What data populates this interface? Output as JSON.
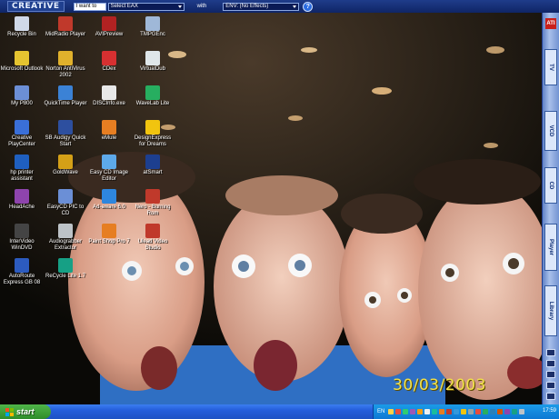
{
  "toolbar": {
    "logo": "CREATIVE",
    "want_label": "I want to",
    "eax_select": "Select EAX",
    "with_label": "with",
    "effect_select": "ENV: (No Effects)"
  },
  "desktop_icons": [
    {
      "name": "recycle-bin",
      "label": "Recycle Bin",
      "color": "#cfd8e8"
    },
    {
      "name": "midradio-player",
      "label": "MidRadio Player",
      "color": "#c0392b"
    },
    {
      "name": "avipreview",
      "label": "AVIPreview",
      "color": "#b22222"
    },
    {
      "name": "tmpgenc",
      "label": "TMPGEnc",
      "color": "#9fb8d8"
    },
    {
      "name": "microsoft-outlook",
      "label": "Microsoft Outlook",
      "color": "#e5c430"
    },
    {
      "name": "norton-antivirus",
      "label": "Norton AntiVirus 2002",
      "color": "#e1b12c"
    },
    {
      "name": "cdex",
      "label": "CDex",
      "color": "#d63031"
    },
    {
      "name": "virtualdub",
      "label": "VirtualDub",
      "color": "#dfe6e9"
    },
    {
      "name": "my-p800",
      "label": "My P800",
      "color": "#6c8fd6"
    },
    {
      "name": "quicktime-player",
      "label": "QuickTime Player",
      "color": "#3b82d6"
    },
    {
      "name": "discinfo",
      "label": "DISCInfo.exe",
      "color": "#e8e8e8"
    },
    {
      "name": "wavelab-lite",
      "label": "WaveLab Lite",
      "color": "#27ae60"
    },
    {
      "name": "creative-playcenter",
      "label": "Creative PlayCenter",
      "color": "#3a6fd8"
    },
    {
      "name": "sb-audigy-quick-start",
      "label": "SB Audigy Quick Start",
      "color": "#2d4f9f"
    },
    {
      "name": "emule",
      "label": "eMule",
      "color": "#e67e22"
    },
    {
      "name": "designexpress",
      "label": "DesignExpress for Dreams",
      "color": "#f1c40f"
    },
    {
      "name": "hp-printer-assistant",
      "label": "hp printer assistant",
      "color": "#1f5fbf"
    },
    {
      "name": "goldwave",
      "label": "GoldWave",
      "color": "#d4a017"
    },
    {
      "name": "easycd-image-editor",
      "label": "Easy CD Image Editor",
      "color": "#5da9e9"
    },
    {
      "name": "atl-tool",
      "label": "atSmart",
      "color": "#1d3f8f"
    },
    {
      "name": "headache",
      "label": "HeadAche",
      "color": "#8e44ad"
    },
    {
      "name": "easycd-pic-to-cd",
      "label": "EasyCD PIC to CD",
      "color": "#6b8fd6"
    },
    {
      "name": "adaware",
      "label": "Ad-aware 6.0",
      "color": "#2e86de"
    },
    {
      "name": "nero-burning-rom",
      "label": "Nero - Burning Rom",
      "color": "#c0392b"
    },
    {
      "name": "intervideo-windvd",
      "label": "InterVideo WinDVD",
      "color": "#444"
    },
    {
      "name": "audiograbber",
      "label": "Audiograbber Extractor",
      "color": "#bdc3c7"
    },
    {
      "name": "paint-shop-pro",
      "label": "Paint Shop Pro 7",
      "color": "#e67e22"
    },
    {
      "name": "dvd-studio",
      "label": "Ulead Video Studio",
      "color": "#c0392b"
    },
    {
      "name": "autoroute",
      "label": "AutoRoute Express GB 08",
      "color": "#2c5bbf"
    },
    {
      "name": "recycle-lite",
      "label": "ReCycle Lite 1.7",
      "color": "#16a085"
    }
  ],
  "sidebar": {
    "top_badge": "ATI",
    "tabs": [
      {
        "name": "tv",
        "label": "TV"
      },
      {
        "name": "vcd",
        "label": "VCD"
      },
      {
        "name": "cd",
        "label": "CD"
      },
      {
        "name": "player",
        "label": "Player"
      },
      {
        "name": "library",
        "label": "Library"
      }
    ]
  },
  "photo": {
    "datestamp": "30/03/2003"
  },
  "taskbar": {
    "start_label": "start",
    "language": "EN",
    "clock": "17:59"
  }
}
